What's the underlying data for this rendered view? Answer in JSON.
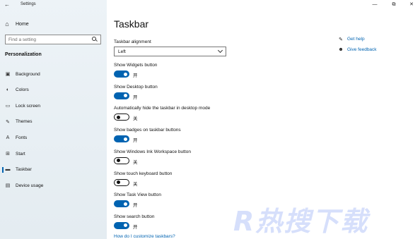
{
  "window": {
    "app_title": "Settings",
    "back_icon": "back-arrow-icon",
    "minimize_glyph": "—",
    "restore_glyph": "⧉",
    "close_glyph": "✕"
  },
  "nav": {
    "home_label": "Home",
    "search_placeholder": "Find a setting",
    "section_title": "Personalization",
    "items": [
      {
        "label": "Background",
        "icon": "background-icon",
        "glyph": "▣",
        "active": false
      },
      {
        "label": "Colors",
        "icon": "colors-icon",
        "glyph": "◐",
        "active": false
      },
      {
        "label": "Lock screen",
        "icon": "lock-screen-icon",
        "glyph": "▭",
        "active": false
      },
      {
        "label": "Themes",
        "icon": "themes-icon",
        "glyph": "✎",
        "active": false
      },
      {
        "label": "Fonts",
        "icon": "fonts-icon",
        "glyph": "A",
        "active": false
      },
      {
        "label": "Start",
        "icon": "start-icon",
        "glyph": "⊞",
        "active": false
      },
      {
        "label": "Taskbar",
        "icon": "taskbar-icon",
        "glyph": "▬",
        "active": true
      },
      {
        "label": "Device usage",
        "icon": "device-usage-icon",
        "glyph": "▤",
        "active": false
      }
    ]
  },
  "main": {
    "title": "Taskbar",
    "alignment": {
      "label": "Taskbar alignment",
      "value": "Left"
    },
    "settings": [
      {
        "label": "Show Widgets button",
        "on": true,
        "state": "开"
      },
      {
        "label": "Show Desktop button",
        "on": true,
        "state": "开"
      },
      {
        "label": "Automatically hide the taskbar in desktop mode",
        "on": false,
        "state": "关"
      },
      {
        "label": "Show badges on taskbar buttons",
        "on": true,
        "state": "开"
      },
      {
        "label": "Show Windows Ink Workspace button",
        "on": false,
        "state": "关"
      },
      {
        "label": "Show touch keyboard button",
        "on": false,
        "state": "关"
      },
      {
        "label": "Show Task View button",
        "on": true,
        "state": "开"
      },
      {
        "label": "Show search button",
        "on": true,
        "state": "开"
      }
    ],
    "bottom_link": "How do I customize taskbars?"
  },
  "help": {
    "get_help": "Get help",
    "give_feedback": "Give feedback"
  },
  "watermark": "R热搜下载",
  "colors": {
    "accent": "#0063b1",
    "nav_bg": "#e7eef3"
  }
}
